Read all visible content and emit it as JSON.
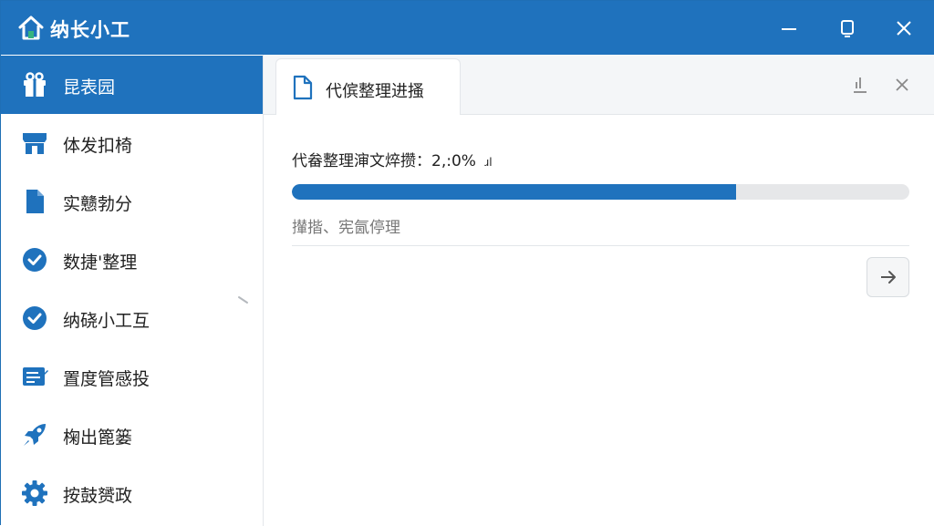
{
  "app": {
    "title": "纳长小工",
    "accent_color": "#1f72bd"
  },
  "titlebar": {
    "icons": [
      "home-icon",
      "minimize-icon",
      "restore-icon",
      "close-icon"
    ]
  },
  "sidebar": {
    "items": [
      {
        "label": "昆表园",
        "icon": "gift-icon",
        "active": true
      },
      {
        "label": "体发扣椅",
        "icon": "store-icon",
        "active": false
      },
      {
        "label": "实戆勃分",
        "icon": "file-icon",
        "active": false
      },
      {
        "label": "数捷'整理",
        "icon": "check-circle-icon",
        "active": false
      },
      {
        "label": "纳硗小工互",
        "icon": "check-circle-icon",
        "active": false
      },
      {
        "label": "置度管感投",
        "icon": "edit-card-icon",
        "active": false
      },
      {
        "label": "椈出篦篓",
        "icon": "rocket-icon",
        "active": false
      },
      {
        "label": "按鼓赟政",
        "icon": "gear-icon",
        "active": false
      }
    ]
  },
  "tab": {
    "label": "代傧整理进搔",
    "icon": "document-icon"
  },
  "tab_actions": {
    "icons": [
      "download-icon",
      "close-tab-icon"
    ]
  },
  "progress": {
    "label": "代畚整理渖文焠攒：",
    "value_text": "2,:0%",
    "suffix": "ɹl",
    "fraction": 0.72
  },
  "status": {
    "text": "攆揩、宪氤停理"
  },
  "next_button": {
    "icon": "arrow-right-icon"
  }
}
